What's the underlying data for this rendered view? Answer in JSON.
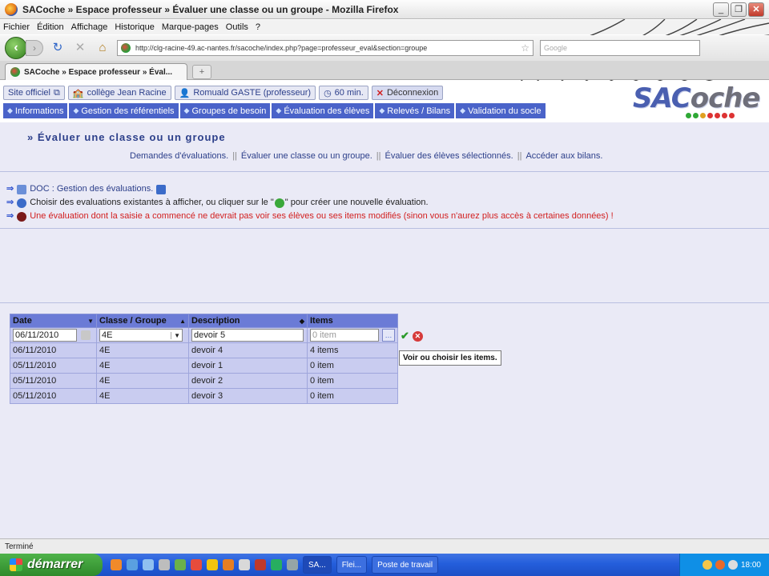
{
  "window": {
    "title": "SACoche » Espace professeur » Évaluer une classe ou un groupe - Mozilla Firefox"
  },
  "menubar": [
    "Fichier",
    "Édition",
    "Affichage",
    "Historique",
    "Marque-pages",
    "Outils",
    "?"
  ],
  "navbar": {
    "url": "http://clg-racine-49.ac-nantes.fr/sacoche/index.php?page=professeur_eval&section=groupe",
    "search_placeholder": "Google"
  },
  "tabs": [
    {
      "label": "SACoche » Espace professeur » Éval..."
    }
  ],
  "userbar": {
    "site": "Site officiel",
    "school": "collège Jean Racine",
    "user": "Romuald GASTE (professeur)",
    "timer": "60 min.",
    "logout": "Déconnexion"
  },
  "mainmenu": [
    "Informations",
    "Gestion des référentiels",
    "Groupes de besoin",
    "Évaluation des élèves",
    "Relevés / Bilans",
    "Validation du socle"
  ],
  "logo": {
    "text_a": "SAC",
    "text_b": "oche"
  },
  "page": {
    "heading": "» Évaluer une classe ou un groupe",
    "subnav": [
      "Demandes d'évaluations.",
      "Évaluer une classe ou un groupe.",
      "Évaluer des élèves sélectionnés.",
      "Accéder aux bilans."
    ],
    "notes": {
      "doc": "DOC : Gestion des évaluations.",
      "info": "Choisir des evaluations existantes à afficher, ou cliquer sur le \"",
      "info_end": "\" pour créer une nouvelle évaluation.",
      "warning": "Une évaluation dont la saisie a commencé ne devrait pas voir ses élèves ou ses items modifiés (sinon vous n'aurez plus accès à certaines données) !"
    }
  },
  "table": {
    "headers": [
      "Date",
      "Classe / Groupe",
      "Description",
      "Items"
    ],
    "edit_row": {
      "date": "06/11/2010",
      "group": "4E",
      "description": "devoir 5",
      "items_placeholder": "0 item"
    },
    "rows": [
      [
        "06/11/2010",
        "4E",
        "devoir 4",
        "4 items"
      ],
      [
        "05/11/2010",
        "4E",
        "devoir 1",
        "0 item"
      ],
      [
        "05/11/2010",
        "4E",
        "devoir 2",
        "0 item"
      ],
      [
        "05/11/2010",
        "4E",
        "devoir 3",
        "0 item"
      ]
    ],
    "tooltip": "Voir ou choisir les items."
  },
  "status": "Terminé",
  "taskbar": {
    "start": "démarrer",
    "tasks": [
      "SA...",
      "Flei...",
      "Poste de travail"
    ],
    "clock": "18:00"
  },
  "colors": {
    "menu_blue": "#4a63c9",
    "table_header": "#6b7bd6",
    "warning_red": "#d21f1f"
  }
}
